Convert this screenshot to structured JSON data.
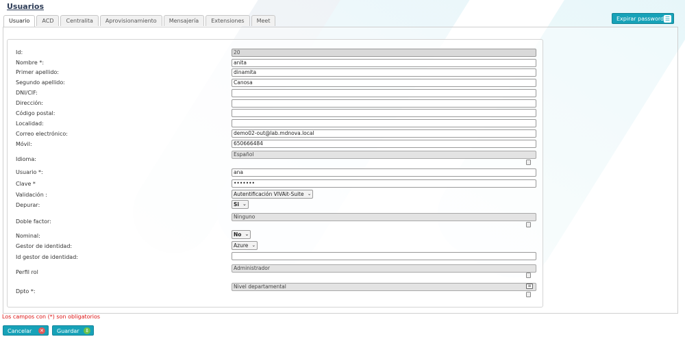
{
  "page": {
    "title": "Usuarios"
  },
  "tabs": [
    {
      "label": "Usuario",
      "active": true
    },
    {
      "label": "ACD"
    },
    {
      "label": "Centralita"
    },
    {
      "label": "Aprovisionamiento"
    },
    {
      "label": "Mensajería"
    },
    {
      "label": "Extensiones"
    },
    {
      "label": "Meet"
    }
  ],
  "toolbar": {
    "expire_password_label": "Expirar password"
  },
  "form": {
    "id": {
      "label": "Id:",
      "value": "20"
    },
    "nombre": {
      "label": "Nombre *:",
      "value": "anita"
    },
    "primer_apellido": {
      "label": "Primer apellido:",
      "value": "dinamita"
    },
    "segundo_apellido": {
      "label": "Segundo apellido:",
      "value": "Canosa"
    },
    "dni": {
      "label": "DNI/CIF:",
      "value": ""
    },
    "direccion": {
      "label": "Dirección:",
      "value": ""
    },
    "codigo_postal": {
      "label": "Código postal:",
      "value": ""
    },
    "localidad": {
      "label": "Localidad:",
      "value": ""
    },
    "correo": {
      "label": "Correo electrónico:",
      "value": "demo02-out@lab.mdnova.local"
    },
    "movil": {
      "label": "Móvil:",
      "value": "650666484"
    },
    "idioma": {
      "label": "Idioma:",
      "value": "Español"
    },
    "usuario": {
      "label": "Usuario *:",
      "value": "ana"
    },
    "clave": {
      "label": "Clave *",
      "value": "•••••••"
    },
    "validacion": {
      "label": "Validación :",
      "value": "Autentificación VIVAit-Suite"
    },
    "depurar": {
      "label": "Depurar:",
      "value": "Si"
    },
    "doble_factor": {
      "label": "Doble factor:",
      "value": "Ninguno"
    },
    "nominal": {
      "label": "Nominal:",
      "value": "No"
    },
    "gestor_identidad": {
      "label": "Gestor de identidad:",
      "value": "Azure"
    },
    "id_gestor": {
      "label": "Id gestor de identidad:",
      "value": ""
    },
    "perfil_rol": {
      "label": "Perfil rol",
      "value": "Administrador"
    },
    "dpto": {
      "label": "Dpto *:",
      "value": "Nivel departamental"
    }
  },
  "footer": {
    "required_note": "Los campos con (*) son obligatorios",
    "cancel_label": "Cancelar",
    "save_label": "Guardar"
  },
  "colors": {
    "accent": "#17a2b8",
    "required_note": "#dd1111"
  }
}
